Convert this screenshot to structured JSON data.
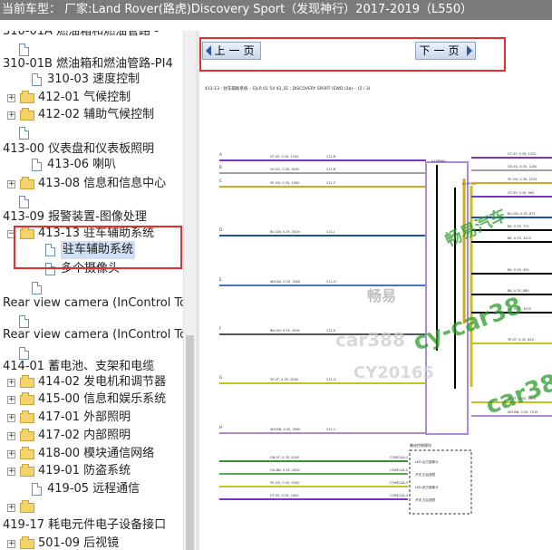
{
  "titlebar": {
    "text": "当前车型：  厂家:Land Rover(路虎)Discovery Sport（发现神行）2017-2019（L550）"
  },
  "tree": {
    "items": [
      {
        "label": "310-01A 燃油箱和燃油管路 -"
      },
      {
        "label": ""
      },
      {
        "label": "310-01B 燃油箱和燃油管路-PI4"
      },
      {
        "label": "310-03 速度控制"
      },
      {
        "label": "412-01 气候控制"
      },
      {
        "label": "412-02 辅助气候控制"
      },
      {
        "label": ""
      },
      {
        "label": "413-00 仪表盘和仪表板照明"
      },
      {
        "label": "413-06 喇叭"
      },
      {
        "label": "413-08 信息和信息中心"
      },
      {
        "label": ""
      },
      {
        "label": "413-09 报警装置-图像处理"
      },
      {
        "label": "413-13 驻车辅助系统"
      },
      {
        "label": "驻车辅助系统"
      },
      {
        "label": "多个摄像头"
      },
      {
        "label": ""
      },
      {
        "label": "Rear view camera (InControl Tou"
      },
      {
        "label": ""
      },
      {
        "label": "Rear view camera (InControl Tou"
      },
      {
        "label": ""
      },
      {
        "label": "414-01 蓄电池、支架和电缆"
      },
      {
        "label": "414-02 发电机和调节器"
      },
      {
        "label": "415-00 信息和娱乐系统"
      },
      {
        "label": "417-01 外部照明"
      },
      {
        "label": "417-02 内部照明"
      },
      {
        "label": "418-00 模块通信网络"
      },
      {
        "label": "419-01 防盗系统"
      },
      {
        "label": "419-05 远程通信"
      },
      {
        "label": ""
      },
      {
        "label": "419-17 耗电元件电子设备接口"
      },
      {
        "label": "501-09 后视镜"
      }
    ]
  },
  "nav": {
    "prev": "上一页",
    "next": "下一页"
  },
  "diagram": {
    "header": "413-13 : 驻车辅助系统 ·· EJLR 01 54 43_2E : DISCOVERY SPORT (EWD (2b) ·· (2 / 3)",
    "pins": [
      "A",
      "B",
      "C",
      "D",
      "E",
      "F",
      "G",
      "H",
      "J",
      "K"
    ],
    "wire_labels": [
      "VT-GY, 0.35, 1100",
      "GY-OG, 0.35, 3000",
      "YE-OG, 0.35, 1050",
      "BU-GN, 0.35, 3000",
      "WH-BU, 0.35, 3000",
      "BN-GN, 0.35, 3000",
      "YE-VT, 0.35, 3000",
      "WH-BN, 0.35, 3000",
      "GN-VT, 0.35, 2000",
      "OG-BN, 0.35, 2000",
      "YE-OG, 0.35, 2000",
      "VT-GY, 0.35, 2000"
    ],
    "right_labels": [
      "VT-GY, 0.35, 1220",
      "GY-OG, 0.35, 1200",
      "YE-OG, 0.35, 1220",
      "VT-GY, 0.35, 965",
      "BU-GN, 0.35, 875",
      "BK, 0.35, 770",
      "BK, 0.35, 1015",
      "BK, 0.35, 430",
      "BK, 0.35, 880",
      "BK, 0.35, 1015",
      "YE-VT, 0.35, 820",
      "YE-VT, 0.35, 3070",
      "WH-BN, 0.35, 1015"
    ],
    "connectors": [
      "C11-B",
      "C11-B",
      "C11-F",
      "C11-J",
      "C11-H",
      "C11-K",
      "C11-G",
      "C11-C"
    ],
    "splices": [
      "S19P96A",
      "S19P96B"
    ],
    "module_title": "集成控制模块",
    "module_units": [
      "LED-后方摄像头",
      "开关-右后视镜",
      "LED-前方摄像头",
      "开关-左后视镜"
    ],
    "module_pins": [
      "C2ME14A-1",
      "C2ME14A-2",
      "C2ME14A-3",
      "C2ME14A-4"
    ],
    "watermarks": [
      "畅易汽车",
      "cy-car38",
      "car38",
      "畅易",
      "car388",
      "CY20165"
    ]
  }
}
